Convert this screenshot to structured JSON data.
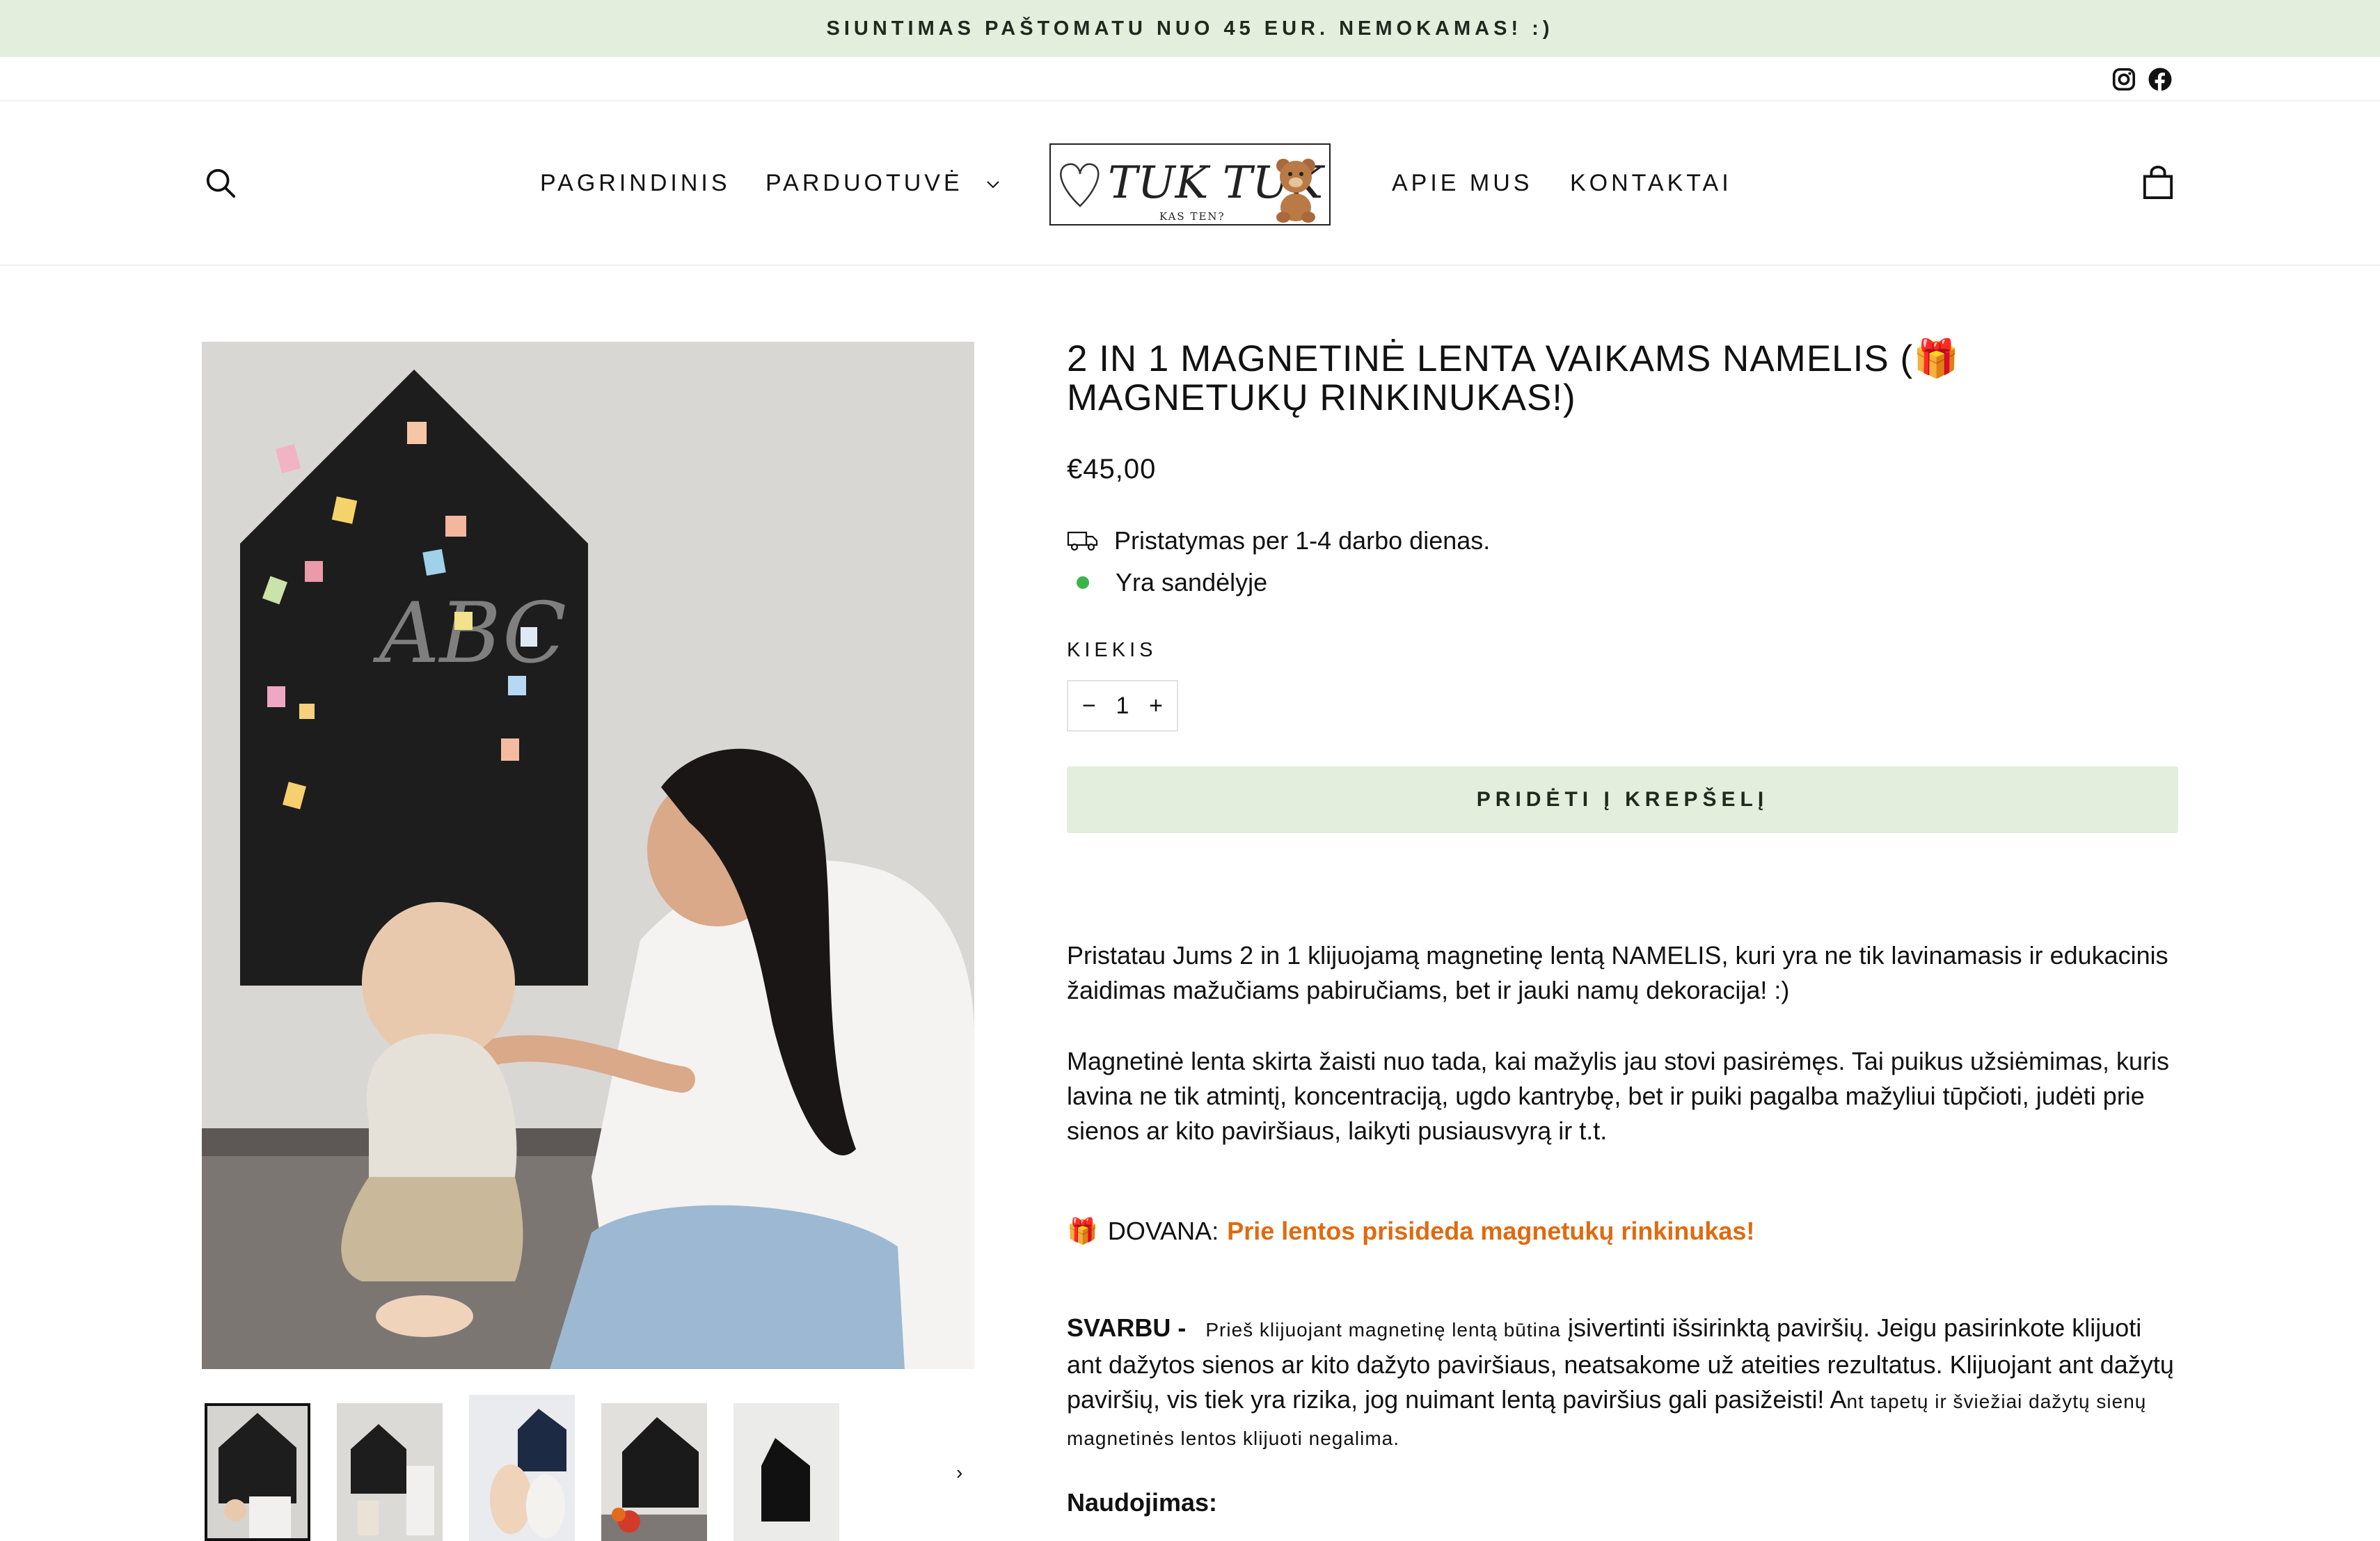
{
  "announcement": "SIUNTIMAS PAŠTOMATU NUO 45 EUR. NEMOKAMAS! :)",
  "social": {
    "instagram_icon": "instagram-icon",
    "facebook_icon": "facebook-icon"
  },
  "nav": {
    "home": "PAGRINDINIS",
    "shop": "PARDUOTUVĖ",
    "about": "APIE MUS",
    "contacts": "KONTAKTAI",
    "search_icon": "search-icon",
    "cart_icon": "cart-icon"
  },
  "logo": {
    "main": "TUK TUK",
    "sub": "KAS TEN?"
  },
  "image_art": {
    "chalk_text": "ABC"
  },
  "product": {
    "title": "2 IN 1 MAGNETINĖ LENTA VAIKAMS NAMELIS (🎁 MAGNETUKŲ RINKINUKAS!)",
    "price": "€45,00",
    "delivery": "Pristatymas per 1-4 darbo dienas.",
    "stock": "Yra sandėlyje",
    "qty_label": "KIEKIS",
    "qty_value": "1",
    "qty_minus": "−",
    "qty_plus": "+",
    "add_to_cart": "PRIDĖTI Į KREPŠELĮ"
  },
  "description": {
    "p1": "Pristatau Jums 2 in 1 klijuojamą magnetinę lentą NAMELIS, kuri yra ne tik lavinamasis ir edukacinis žaidimas mažučiams pabiručiams, bet ir jauki namų dekoracija! :)",
    "p2": "Magnetinė lenta skirta žaisti nuo tada, kai mažylis jau stovi pasirėmęs. Tai puikus užsiėmimas, kuris lavina ne tik atmintį, koncentraciją, ugdo kantrybę, bet ir puiki pagalba mažyliui tūpčioti, judėti prie sienos ar kito paviršiaus, laikyti pusiausvyrą ir t.t.",
    "gift_icon": "🎁",
    "gift_label": "DOVANA:",
    "gift_text": "Prie lentos prisideda magnetukų rinkinukas!",
    "important_label": "SVARBU -",
    "important_small": "Prieš klijuojant magnetinę lentą būtina",
    "important_main": "įsivertinti išsirinktą paviršių. Jeigu pasirinkote klijuoti ant dažytos sienos ar kito dažyto paviršiaus, neatsakome už ateities rezultatus. Klijuojant ant dažytų paviršių, vis tiek yra rizika, jog nuimant lentą paviršius gali pasižeisti! A",
    "important_tail": "nt tapetų ir šviežiai dažytų sienų magnetinės lentos klijuoti negalima.",
    "usage_label": "Naudojimas:"
  },
  "thumbnails_next": "›"
}
